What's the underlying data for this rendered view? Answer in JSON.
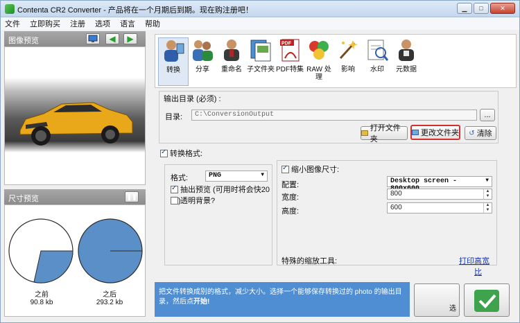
{
  "window": {
    "title": "Contenta CR2 Converter - 产品将在一个月期后到期。现在购注册吧！",
    "controls": [
      "minimize",
      "maximize",
      "close"
    ]
  },
  "menu": [
    "文件",
    "立即购买",
    "注册",
    "选项",
    "语言",
    "帮助"
  ],
  "image_preview": {
    "title": "图像预览"
  },
  "size_preview": {
    "title": "尺寸预览",
    "before_label": "之前",
    "before_size": "90.8 kb",
    "after_label": "之后",
    "after_size": "293.2 kb"
  },
  "toolbar": {
    "tools": [
      {
        "label": "转换",
        "icon": "convert-icon"
      },
      {
        "label": "分享",
        "icon": "share-icon"
      },
      {
        "label": "重命名",
        "icon": "rename-icon"
      },
      {
        "label": "子文件夹",
        "icon": "subfolder-icon"
      },
      {
        "label": "PDF特集",
        "icon": "pdf-icon"
      },
      {
        "label": "RAW 处理",
        "icon": "raw-icon"
      },
      {
        "label": "影响",
        "icon": "effects-icon"
      },
      {
        "label": "水印",
        "icon": "watermark-icon"
      },
      {
        "label": "元数据",
        "icon": "metadata-icon"
      }
    ]
  },
  "output": {
    "group_label": "输出目录 (必须) :",
    "dir_label": "目录:",
    "dir_value": "C:\\ConversionOutput",
    "browse": "...",
    "open_folder": "打开文件夹",
    "change_folder": "更改文件夹",
    "clear": "清除"
  },
  "convert_format": {
    "label": "转换格式:",
    "format_label": "格式:",
    "format_value": "PNG",
    "extract_preview": "抽出预览 (可用时将会快20倍)",
    "transparent_bg": "透明背景?"
  },
  "resize": {
    "label": "缩小图像尺寸:",
    "config_label": "配置:",
    "config_value": "Desktop screen - 800x600",
    "width_label": "宽度:",
    "width_value": "800",
    "height_label": "高度:",
    "height_value": "600",
    "special_tools_label": "特殊的缩放工具:",
    "print_link": "打印",
    "hd_link": "高宽比"
  },
  "hint": {
    "text": "把文件转换成别的格式，减少大小。选择一个能够保存转换过的 photo 的输出目录，然后点",
    "bold": "开始!"
  },
  "start_button_label": "选"
}
